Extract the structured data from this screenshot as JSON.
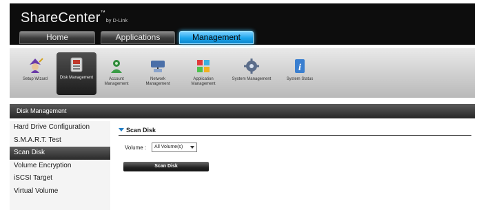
{
  "brand": {
    "name": "ShareCenter",
    "tm": "™",
    "sub": "by D-Link"
  },
  "top_tabs": [
    {
      "label": "Home"
    },
    {
      "label": "Applications"
    },
    {
      "label": "Management",
      "active": true
    }
  ],
  "icons": [
    {
      "label": "Setup Wizard",
      "icon": "wizard-icon"
    },
    {
      "label": "Disk Management",
      "icon": "disk-icon",
      "active": true
    },
    {
      "label": "Account Management",
      "icon": "account-icon"
    },
    {
      "label": "Network Management",
      "icon": "network-icon"
    },
    {
      "label": "Application Management",
      "icon": "application-icon"
    },
    {
      "label": "System Management",
      "icon": "system-icon"
    },
    {
      "label": "System Status",
      "icon": "info-icon"
    }
  ],
  "section_title": "Disk Management",
  "sidebar": [
    {
      "label": "Hard Drive Configuration"
    },
    {
      "label": "S.M.A.R.T. Test"
    },
    {
      "label": "Scan Disk",
      "active": true
    },
    {
      "label": "Volume Encryption"
    },
    {
      "label": "iSCSI Target"
    },
    {
      "label": "Virtual Volume"
    }
  ],
  "panel": {
    "title": "Scan Disk",
    "volume_label": "Volume :",
    "volume_value": "All Volume(s)",
    "button_label": "Scan Disk"
  },
  "colors": {
    "accent": "#1da6ec",
    "title_triangle": "#1f7cc4"
  }
}
